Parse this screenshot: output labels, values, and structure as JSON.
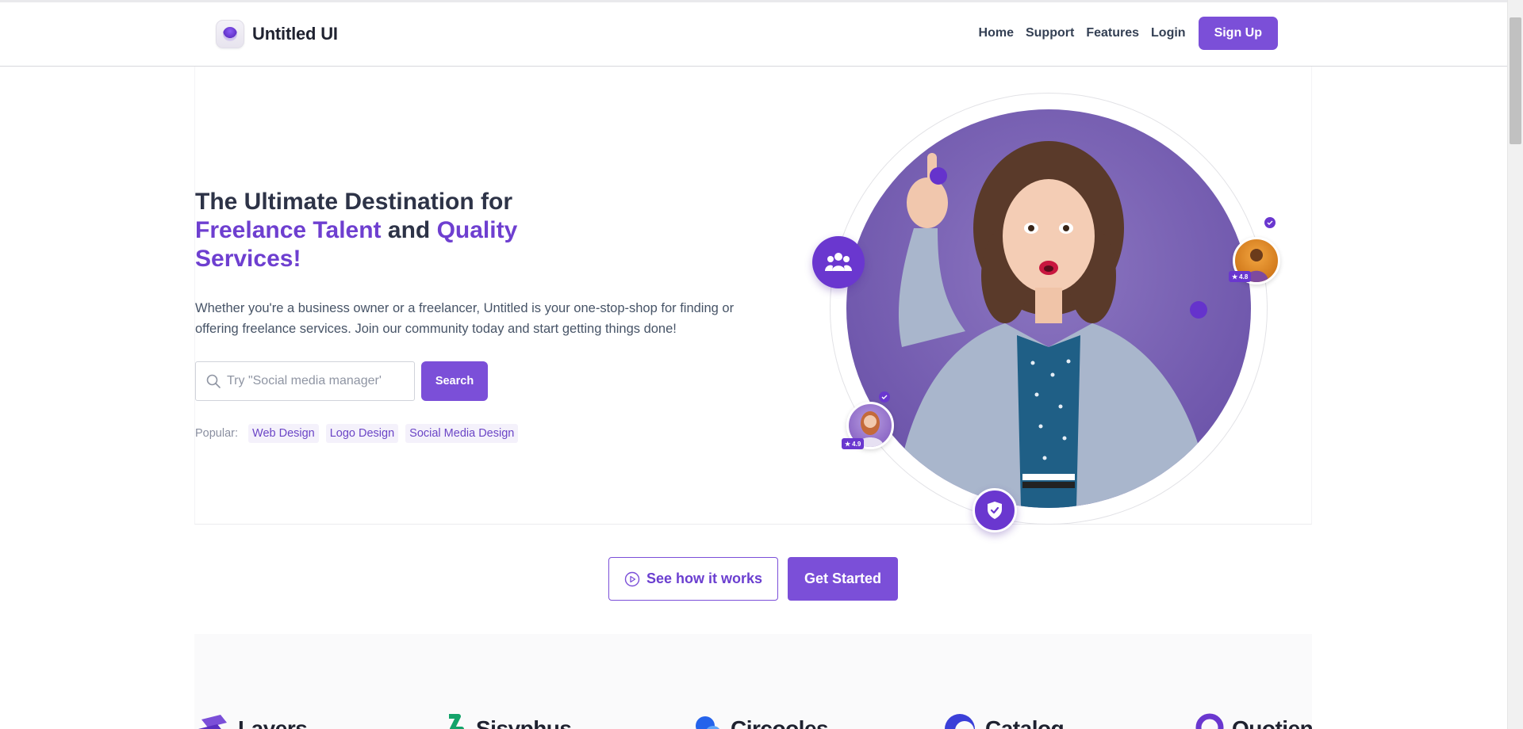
{
  "header": {
    "brand": "Untitled UI",
    "nav": [
      "Home",
      "Support",
      "Features",
      "Login"
    ],
    "signup_label": "Sign Up"
  },
  "hero": {
    "title_line1": "The Ultimate Destination for",
    "title_accent1": "Freelance Talent",
    "title_and": "and",
    "title_accent2": "Quality",
    "title_accent3": "Services!",
    "description": "Whether you're a business owner or a freelancer, Untitled is your one-stop-shop for finding or offering freelance services. Join our community today and start getting things done!",
    "search": {
      "placeholder": "Try \"Social media manager'",
      "button_label": "Search"
    },
    "popular_label": "Popular:",
    "popular_tags": [
      "Web Design",
      "Logo Design",
      "Social Media Design"
    ],
    "ratings": {
      "right": "4.8",
      "left": "4.9"
    }
  },
  "cta": {
    "secondary_label": "See how it works",
    "primary_label": "Get Started"
  },
  "logos": [
    "Layers",
    "Sisyphus",
    "Circooles",
    "Catalog",
    "Quotient"
  ],
  "colors": {
    "accent": "#7b4fd8",
    "accent_dark": "#6a37cf",
    "heading": "#2d3347",
    "text": "#475467"
  }
}
